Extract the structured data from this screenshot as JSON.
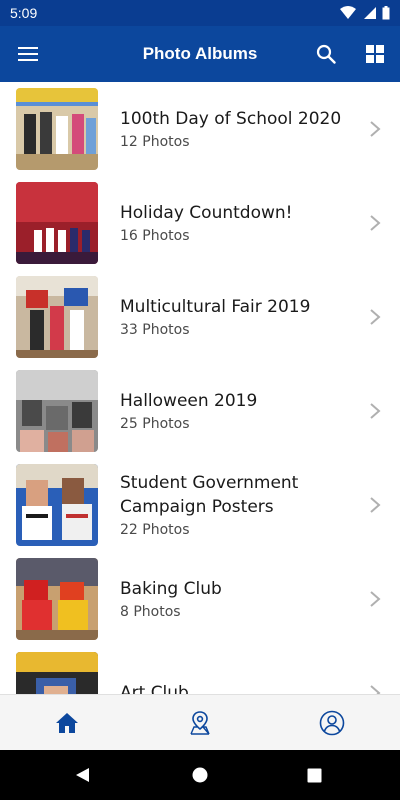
{
  "status_bar": {
    "time": "5:09"
  },
  "app_bar": {
    "title": "Photo Albums"
  },
  "albums": [
    {
      "title": "100th Day of School 2020",
      "count": "12 Photos"
    },
    {
      "title": "Holiday Countdown!",
      "count": "16 Photos"
    },
    {
      "title": "Multicultural Fair 2019",
      "count": "33 Photos"
    },
    {
      "title": "Halloween 2019",
      "count": "25 Photos"
    },
    {
      "title": "Student Government Campaign Posters",
      "count": "22 Photos"
    },
    {
      "title": "Baking Club",
      "count": "8 Photos"
    },
    {
      "title": "Art Club",
      "count": ""
    }
  ],
  "icons": {
    "menu": "menu-icon",
    "search": "search-icon",
    "grid": "grid-view-icon",
    "home": "home-icon",
    "locations": "map-pin-icon",
    "profile": "profile-icon"
  },
  "colors": {
    "app_bar": "#0c479d",
    "status_bar": "#0a3d91",
    "nav_icon": "#0c479d"
  }
}
